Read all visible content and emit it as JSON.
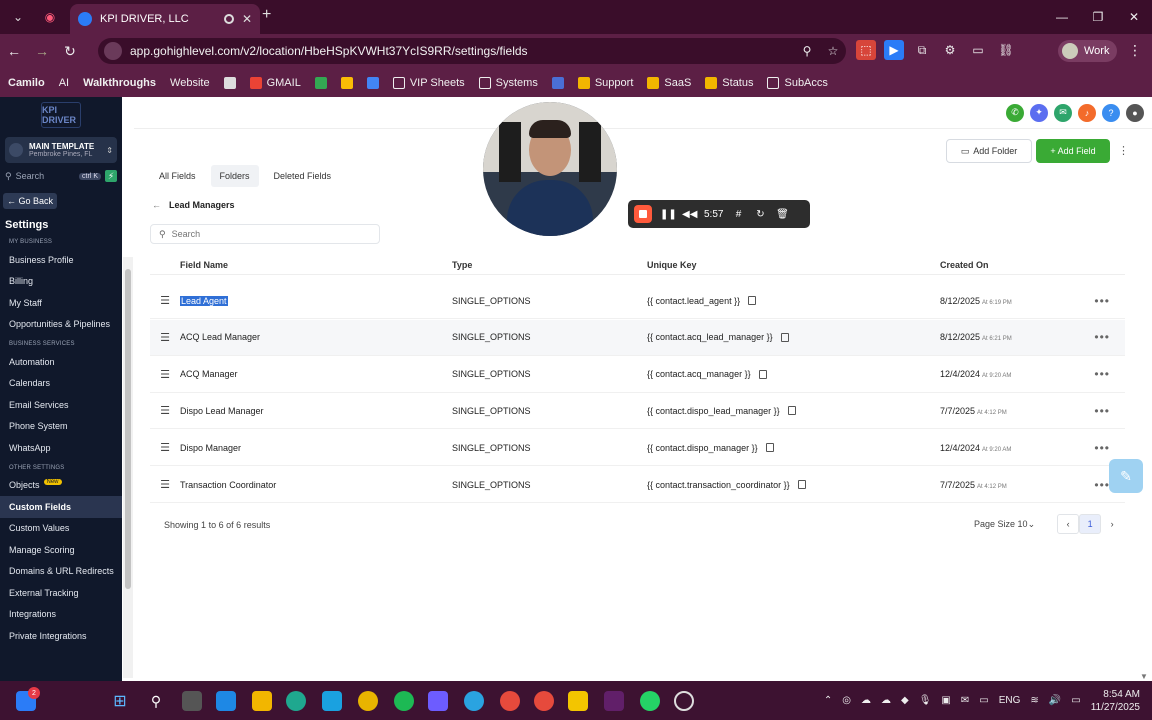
{
  "browser": {
    "tab_title": "KPI DRIVER, LLC",
    "url": "app.gohighlevel.com/v2/location/HbeHSpKVWHt37YcIS9RR/settings/fields",
    "profile_label": "Work"
  },
  "bookmarks": [
    {
      "label": "Camilo",
      "icon": "text-only"
    },
    {
      "label": "AI",
      "icon": "text-only"
    },
    {
      "label": "Walkthroughs",
      "icon": "text-only"
    },
    {
      "label": "Website",
      "icon": "text-only"
    },
    {
      "label": "",
      "icon": "apps-grid-icon"
    },
    {
      "label": "GMAIL",
      "icon": "gmail-icon"
    },
    {
      "label": "",
      "icon": "drive-icon"
    },
    {
      "label": "",
      "icon": "chrome-icon"
    },
    {
      "label": "",
      "icon": "calendar-icon"
    },
    {
      "label": "VIP Sheets",
      "icon": "folder-icon"
    },
    {
      "label": "Systems",
      "icon": "folder-icon"
    },
    {
      "label": "",
      "icon": "doc-icon"
    },
    {
      "label": "Support",
      "icon": "chart-icon"
    },
    {
      "label": "SaaS",
      "icon": "chart-icon"
    },
    {
      "label": "Status",
      "icon": "chart-icon"
    },
    {
      "label": "SubAccs",
      "icon": "folder-icon"
    }
  ],
  "sidebar": {
    "logo_text": "KPI DRIVER",
    "location_name": "MAIN TEMPLATE",
    "location_sub": "Pembroke Pines, FL",
    "search_placeholder": "Search",
    "search_shortcut": "ctrl K",
    "go_back": "Go Back",
    "settings_heading": "Settings",
    "sections": [
      {
        "heading": "MY BUSINESS",
        "items": [
          "Business Profile",
          "Billing",
          "My Staff",
          "Opportunities & Pipelines"
        ]
      },
      {
        "heading": "BUSINESS SERVICES",
        "items": [
          "Automation",
          "Calendars",
          "Email Services",
          "Phone System",
          "WhatsApp"
        ]
      },
      {
        "heading": "OTHER SETTINGS",
        "items": [
          "Objects",
          "Custom Fields",
          "Custom Values",
          "Manage Scoring",
          "Domains & URL Redirects",
          "External Tracking",
          "Integrations",
          "Private Integrations"
        ]
      }
    ],
    "new_badge": "New",
    "active_item": "Custom Fields"
  },
  "toolbar": {
    "add_folder": "Add Folder",
    "add_field": "+ Add Field"
  },
  "tabs": [
    "All Fields",
    "Folders",
    "Deleted Fields"
  ],
  "active_tab": "Folders",
  "breadcrumb": "Lead Managers",
  "search_placeholder": "Search",
  "table": {
    "headers": [
      "Field Name",
      "Type",
      "Unique Key",
      "Created On"
    ],
    "rows": [
      {
        "name": "Lead Agent",
        "type": "SINGLE_OPTIONS",
        "key": "{{ contact.lead_agent }}",
        "date": "8/12/2025",
        "time": "At 6:19 PM"
      },
      {
        "name": "ACQ Lead Manager",
        "type": "SINGLE_OPTIONS",
        "key": "{{ contact.acq_lead_manager }}",
        "date": "8/12/2025",
        "time": "At 6:21 PM"
      },
      {
        "name": "ACQ Manager",
        "type": "SINGLE_OPTIONS",
        "key": "{{ contact.acq_manager }}",
        "date": "12/4/2024",
        "time": "At 9:20 AM"
      },
      {
        "name": "Dispo Lead Manager",
        "type": "SINGLE_OPTIONS",
        "key": "{{ contact.dispo_lead_manager }}",
        "date": "7/7/2025",
        "time": "At 4:12 PM"
      },
      {
        "name": "Dispo Manager",
        "type": "SINGLE_OPTIONS",
        "key": "{{ contact.dispo_manager }}",
        "date": "12/4/2024",
        "time": "At 9:20 AM"
      },
      {
        "name": "Transaction Coordinator",
        "type": "SINGLE_OPTIONS",
        "key": "{{ contact.transaction_coordinator }}",
        "date": "7/7/2025",
        "time": "At 4:12 PM"
      }
    ]
  },
  "pagination": {
    "showing_prefix": "Showing",
    "from": "1",
    "to_word": "to",
    "to": "6",
    "of_word": "of",
    "total": "6",
    "suffix": "results",
    "page_size_label": "Page Size",
    "page_size": "10",
    "current_page": "1"
  },
  "recorder": {
    "elapsed": "5:57"
  },
  "taskbar": {
    "language": "ENG",
    "time": "8:54 AM",
    "date": "11/27/2025",
    "badge_count": "2"
  },
  "colors": {
    "tab_bar": "#3a0d2a",
    "sidebar_bg": "#10182b",
    "primary_green": "#3aaa35",
    "selection": "#2f6fd6"
  }
}
